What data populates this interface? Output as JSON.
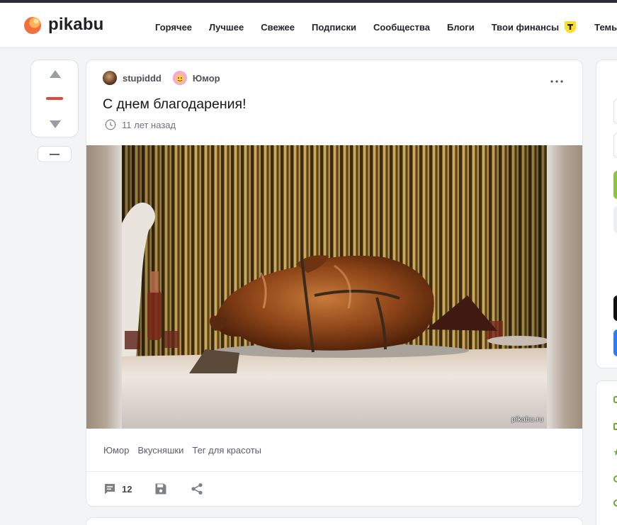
{
  "app": {
    "logo_text": "pikabu",
    "accent": "#f2703e"
  },
  "nav": {
    "items": [
      "Горячее",
      "Лучшее",
      "Свежее",
      "Подписки",
      "Сообщества",
      "Блоги",
      "Твои финансы",
      "Темы"
    ],
    "finance_badge_color": "#ffdd2d"
  },
  "vote": {
    "up_icon": "arrow-up-icon",
    "down_icon": "arrow-down-icon",
    "rating_mark_color": "#e0483b"
  },
  "post": {
    "author": "stupiddd",
    "community": "Юмор",
    "title": "С днем благодарения!",
    "time": "11 лет назад",
    "image_watermark": "pikabu.ru",
    "tags": [
      "Юмор",
      "Вкусняшки",
      "Тег для красоты"
    ],
    "comments_count": "12"
  }
}
